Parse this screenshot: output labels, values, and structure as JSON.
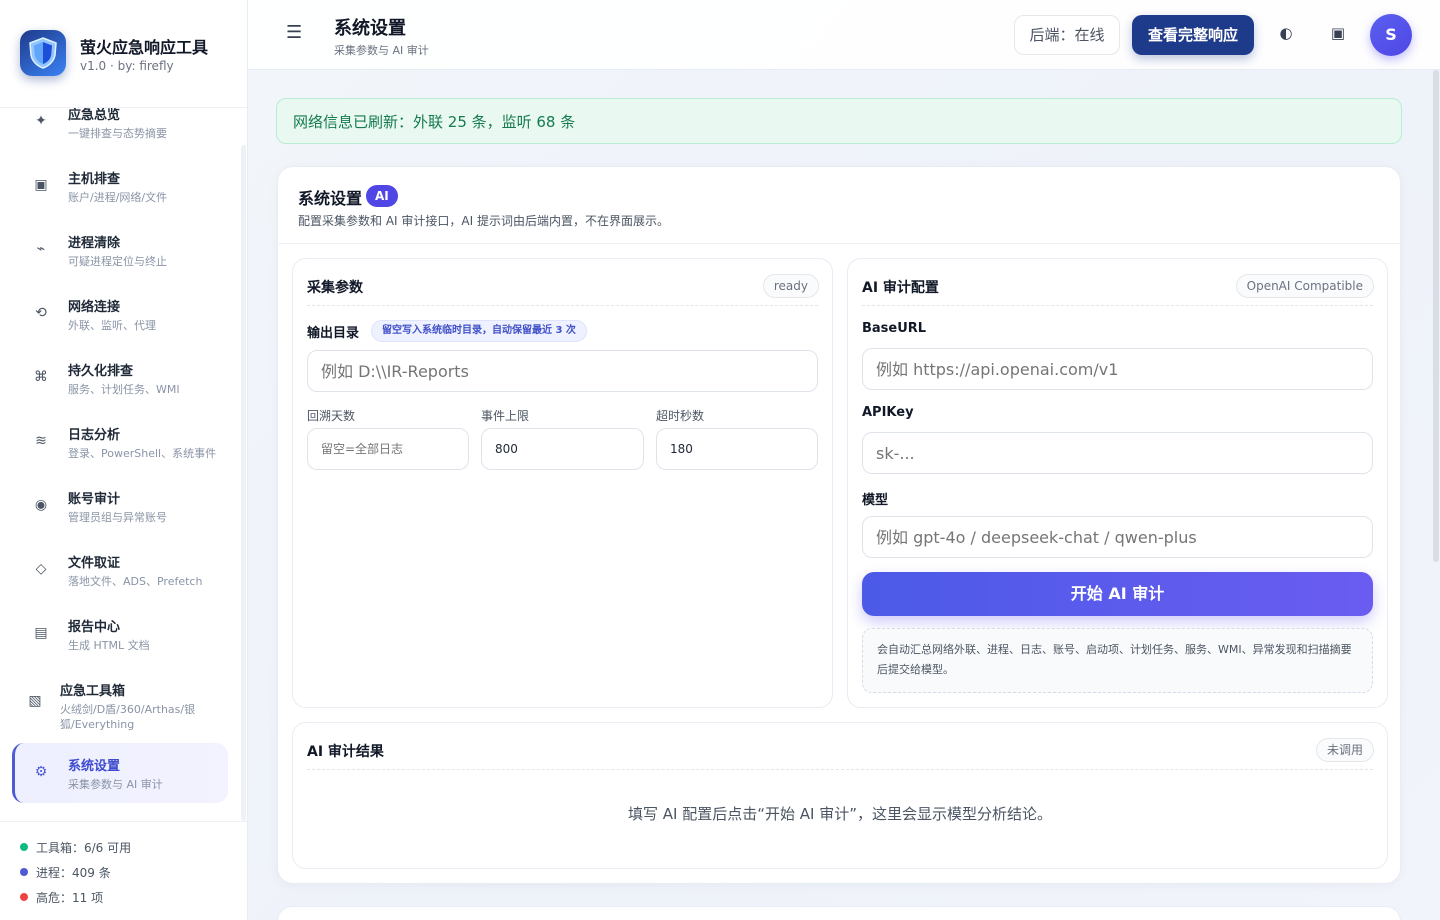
{
  "brand": {
    "title": "萤火应急响应工具",
    "subtitle": "v1.0 · by: firefly"
  },
  "nav": {
    "items": [
      {
        "label": "应急总览",
        "sub": "一键排查与态势摘要",
        "icon": "sparkle-icon",
        "glyph": "✦"
      },
      {
        "label": "主机排查",
        "sub": "账户/进程/网络/文件",
        "icon": "host-icon",
        "glyph": "▣"
      },
      {
        "label": "进程清除",
        "sub": "可疑进程定位与终止",
        "icon": "process-icon",
        "glyph": "⌁"
      },
      {
        "label": "网络连接",
        "sub": "外联、监听、代理",
        "icon": "refresh-icon",
        "glyph": "⟲"
      },
      {
        "label": "持久化排查",
        "sub": "服务、计划任务、WMI",
        "icon": "command-icon",
        "glyph": "⌘"
      },
      {
        "label": "日志分析",
        "sub": "登录、PowerShell、系统事件",
        "icon": "wave-icon",
        "glyph": "≋"
      },
      {
        "label": "账号审计",
        "sub": "管理员组与异常账号",
        "icon": "user-icon",
        "glyph": "◉"
      },
      {
        "label": "文件取证",
        "sub": "落地文件、ADS、Prefetch",
        "icon": "diamond-icon",
        "glyph": "◇"
      },
      {
        "label": "报告中心",
        "sub": "生成 HTML 文档",
        "icon": "report-icon",
        "glyph": "▤"
      },
      {
        "label": "应急工具箱",
        "sub": "火绒剑/D盾/360/Arthas/银狐/Everything",
        "icon": "toolbox-icon",
        "glyph": "▧"
      },
      {
        "label": "系统设置",
        "sub": "采集参数与 AI 审计",
        "icon": "gear-icon",
        "glyph": "⚙"
      }
    ],
    "active_index": 10
  },
  "sidebar_stats": [
    {
      "text": "工具箱：6/6 可用",
      "color": "#10b981"
    },
    {
      "text": "进程：409 条",
      "color": "#4f5bd5"
    },
    {
      "text": "高危：11 项",
      "color": "#ef4444"
    }
  ],
  "header": {
    "menu_glyph": "☰",
    "title": "系统设置",
    "subtitle": "采集参数与 AI 审计",
    "status": "后端：在线",
    "primary_button": "查看完整响应",
    "theme_glyph": "◐",
    "window_glyph": "▣",
    "avatar": "S"
  },
  "notice": "网络信息已刷新：外联 25 条，监听 68 条",
  "settings": {
    "title": "系统设置",
    "badge": "AI",
    "description": "配置采集参数和 AI 审计接口，AI 提示词由后端内置，不在界面展示。",
    "collect": {
      "title": "采集参数",
      "tag": "ready",
      "output_label": "输出目录",
      "output_hint": "留空写入系统临时目录，自动保留最近 3 次",
      "output_placeholder": "例如 D:\\\\IR-Reports",
      "days_label": "回溯天数",
      "days_placeholder": "留空=全部日志",
      "limit_label": "事件上限",
      "limit_value": "800",
      "timeout_label": "超时秒数",
      "timeout_value": "180"
    },
    "ai": {
      "title": "AI 审计配置",
      "tag": "OpenAI Compatible",
      "baseurl_label": "BaseURL",
      "baseurl_placeholder": "例如 https://api.openai.com/v1",
      "apikey_label": "APIKey",
      "apikey_placeholder": "sk-...",
      "model_label": "模型",
      "model_placeholder": "例如 gpt-4o / deepseek-chat / qwen-plus",
      "start_button": "开始 AI 审计",
      "note": "会自动汇总网络外联、进程、日志、账号、启动项、计划任务、服务、WMI、异常发现和扫描摘要后提交给模型。"
    },
    "result": {
      "title": "AI 审计结果",
      "tag": "未调用",
      "message": "填写 AI 配置后点击“开始 AI 审计”，这里会显示模型分析结论。"
    }
  }
}
